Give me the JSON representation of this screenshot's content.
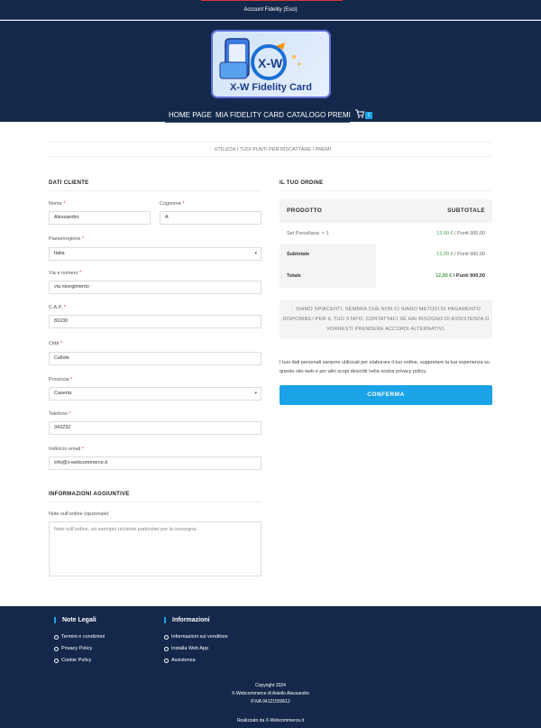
{
  "topbar": {
    "account_link": "Account Fidelity (Esci)"
  },
  "logo": {
    "text": "X-W Fidelity Card"
  },
  "nav": {
    "items": [
      "HOME PAGE",
      "MIA FIDELITY CARD",
      "CATALOGO PREMI"
    ],
    "cart_count": "1"
  },
  "notice": "UTILIZZA I TUOI PUNTI PER RISCATTARE I PREMI",
  "billing": {
    "title": "DATI CLIENTE",
    "first_name_label": "Nome",
    "first_name": "Alessandro",
    "last_name_label": "Cognome",
    "last_name": "A",
    "country_label": "Paese/regione",
    "country": "Italia",
    "street_label": "Via e numero",
    "street": "via risorgimento",
    "zip_label": "C.A.P.",
    "zip": "81030",
    "city_label": "Città",
    "city": "Cellole",
    "province_label": "Provincia",
    "province": "Caserta",
    "phone_label": "Telefono",
    "phone": "343232",
    "email_label": "Indirizzo email",
    "email": "info@x-webcommerce.it"
  },
  "additional": {
    "title": "INFORMAZIONI AGGIUNTIVE",
    "notes_label": "Note sull'ordine (opzionale)",
    "notes_placeholder": "Note sull'ordine, ad esempio richieste particolari per la consegna."
  },
  "order": {
    "title": "IL TUO ORDINE",
    "col_product": "PRODOTTO",
    "col_subtotal": "SUBTOTALE",
    "item_name": "Set Porcellana",
    "item_qty": "× 1",
    "item_price": "12,00 €",
    "item_points": "/ Punti 900,00",
    "subtotal_label": "Subtotale",
    "subtotal_price": "12,00 €",
    "subtotal_points": "/ Punti 900,00",
    "total_label": "Totale",
    "total_price": "12,00 €",
    "total_points": "/ Punti 900,00"
  },
  "payment_notice": "SIAMO SPIACENTI, SEMBRA CHE NON CI SIANO METODI DI PAGAMENTO DISPONIBILI PER IL TUO STATO. CONTATTACI SE HAI BISOGNO DI ASSISTENZA O VORRESTI PRENDERE ACCORDI ALTERNATIVI.",
  "privacy_text": "I tuoi dati personali saranno utilizzati per elaborare il tuo ordine, supportare la tua esperienza su questo sito web e per altri scopi descritti nella nostra privacy policy.",
  "confirm_label": "CONFERMA",
  "footer": {
    "legal_title": "Note Legali",
    "legal_items": [
      "Termini e condizioni",
      "Privacy Policy",
      "Cookie Policy"
    ],
    "info_title": "Informazioni",
    "info_items": [
      "Informazioni sul venditore",
      "Installa Web App",
      "Assistenza"
    ],
    "copyright": "Copyright 2024",
    "company": "X-Webcommerce di Aniello Alessandro",
    "vat": "P.IVA 04121550612",
    "credit": "Realizzato da X-Webcommerce.it"
  },
  "colors": {
    "navy": "#13284a",
    "accent": "#1ba3e8",
    "price_green": "#43a047"
  }
}
